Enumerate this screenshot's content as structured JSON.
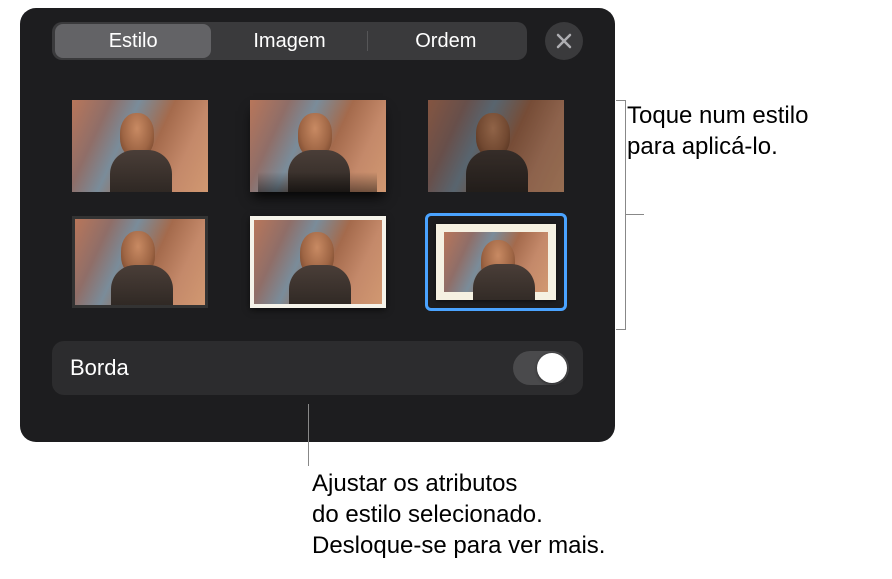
{
  "tabs": {
    "style": "Estilo",
    "image": "Imagem",
    "order": "Ordem"
  },
  "option": {
    "border_label": "Borda"
  },
  "callouts": {
    "right_line1": "Toque num estilo",
    "right_line2": "para aplicá-lo.",
    "bottom_line1": "Ajustar os atributos",
    "bottom_line2": "do estilo selecionado.",
    "bottom_line3": "Desloque-se para ver mais."
  },
  "styles": [
    {
      "id": "style-1"
    },
    {
      "id": "style-2"
    },
    {
      "id": "style-3"
    },
    {
      "id": "style-4"
    },
    {
      "id": "style-5"
    },
    {
      "id": "style-6"
    }
  ]
}
